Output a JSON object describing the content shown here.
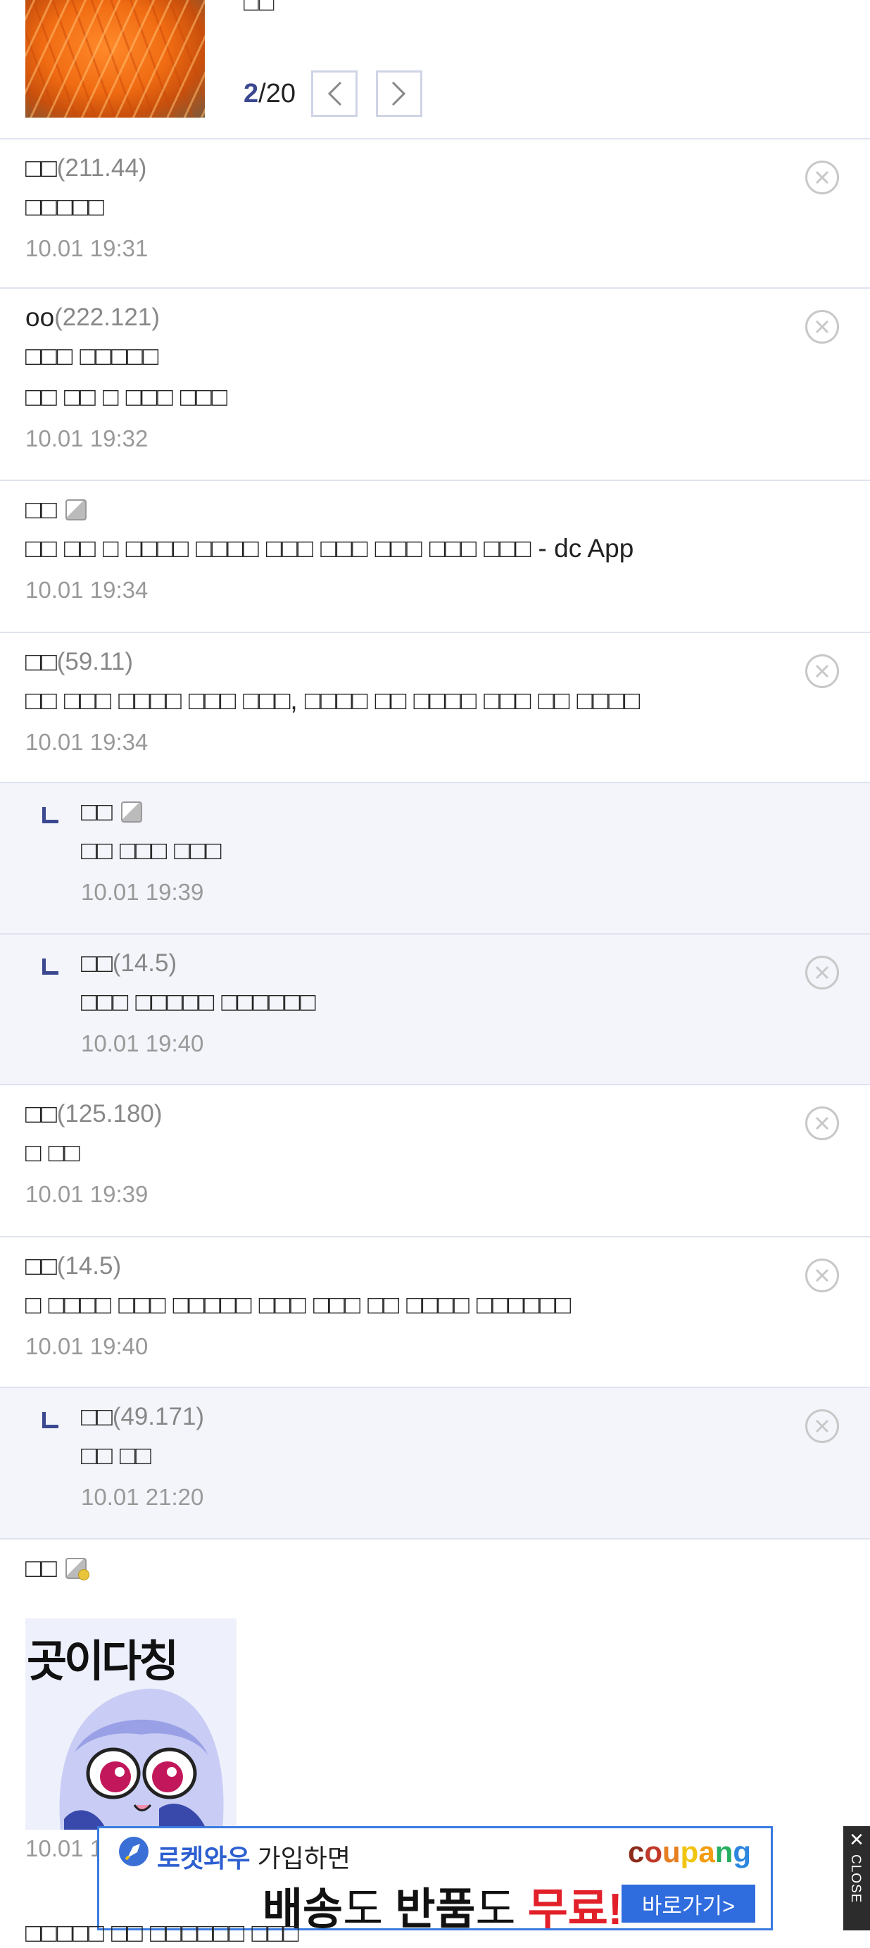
{
  "top_card": {
    "title": "□□",
    "pager": {
      "current": "2",
      "total": "/20"
    }
  },
  "comments": [
    {
      "nick": "□□",
      "ip": "(211.44)",
      "lines": [
        "□□□□□"
      ],
      "date": "10.01 19:31",
      "reply": false,
      "app": false,
      "delete": true
    },
    {
      "nick": "oo",
      "ip": "(222.121)",
      "lines": [
        "□□□ □□□□□",
        "□□ □□ □ □□□ □□□"
      ],
      "date": "10.01 19:32",
      "reply": false,
      "app": false,
      "delete": true
    },
    {
      "nick": "□□",
      "ip": "",
      "lines": [
        "□□ □□ □ □□□□ □□□□ □□□ □□□ □□□ □□□ □□□ - dc App"
      ],
      "date": "10.01 19:34",
      "reply": false,
      "app": true,
      "delete": false
    },
    {
      "nick": "□□",
      "ip": "(59.11)",
      "lines": [
        "□□ □□□ □□□□ □□□ □□□, □□□□ □□ □□□□ □□□ □□ □□□□"
      ],
      "date": "10.01 19:34",
      "reply": false,
      "app": false,
      "delete": true
    },
    {
      "nick": "□□",
      "ip": "",
      "lines": [
        "□□ □□□ □□□"
      ],
      "date": "10.01 19:39",
      "reply": true,
      "app": true,
      "delete": false
    },
    {
      "nick": "□□",
      "ip": "(14.5)",
      "lines": [
        "□□□ □□□□□ □□□□□□"
      ],
      "date": "10.01 19:40",
      "reply": true,
      "app": false,
      "delete": true
    },
    {
      "nick": "□□",
      "ip": "(125.180)",
      "lines": [
        "□ □□"
      ],
      "date": "10.01 19:39",
      "reply": false,
      "app": false,
      "delete": true
    },
    {
      "nick": "□□",
      "ip": "(14.5)",
      "lines": [
        "□ □□□□ □□□ □□□□□ □□□ □□□ □□ □□□□ □□□□□□"
      ],
      "date": "10.01 19:40",
      "reply": false,
      "app": false,
      "delete": true
    },
    {
      "nick": "□□",
      "ip": "(49.171)",
      "lines": [
        "□□ □□"
      ],
      "date": "10.01 21:20",
      "reply": true,
      "app": false,
      "delete": true
    }
  ],
  "sticker_comment": {
    "nick": "□□",
    "sticker_text": "곳이다칭",
    "date": "10.01 19:41"
  },
  "ad": {
    "line1_brand": "로켓와우",
    "line1_rest": " 가입하면",
    "brand": "coupang",
    "line2_a": "배송",
    "line2_b": "도 ",
    "line2_c": "반품",
    "line2_d": "도 ",
    "line2_e": "무료!",
    "cta": "바로가기>",
    "close_x": "✕",
    "close_word": "CLOSE"
  },
  "below_ad_text": "□□□□□ □□ □□□□□□ □□□",
  "colors": {
    "accent": "#3b4890",
    "divider": "#dfe3ee",
    "reply_bg": "#f3f5fa",
    "meta_gray": "#999999",
    "ad_blue": "#2f6cde",
    "ad_red": "#e2202a"
  }
}
